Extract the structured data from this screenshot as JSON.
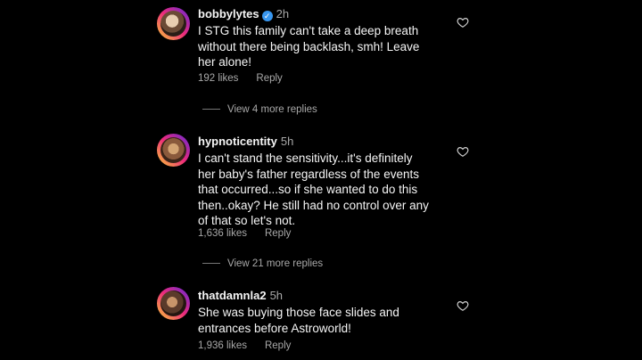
{
  "comments": [
    {
      "username": "bobbylytes",
      "verified": true,
      "time": "2h",
      "text_lines": [
        "I STG this family can't take a deep breath",
        "without there being backlash, smh! Leave",
        "her alone!"
      ],
      "likes": "192 likes",
      "reply": "Reply",
      "view_replies": "View 4 more replies"
    },
    {
      "username": "hypnoticentity",
      "verified": false,
      "time": "5h",
      "text_lines": [
        "I can't stand the sensitivity...it's definitely",
        "her baby's father regardless of the events",
        "that occurred...so if she wanted to do this",
        "then..okay? He still had no control over any",
        "of that so let's not."
      ],
      "likes": "1,636 likes",
      "reply": "Reply",
      "view_replies": "View 21 more replies"
    },
    {
      "username": "thatdamnla2",
      "verified": false,
      "time": "5h",
      "text_lines": [
        "She was buying those face slides and",
        "entrances before Astroworld!"
      ],
      "likes": "1,936 likes",
      "reply": "Reply"
    }
  ],
  "icons": {
    "heart": "heart-outline-icon",
    "verified": "verified-badge-icon",
    "avatar": "avatar-story-ring"
  }
}
